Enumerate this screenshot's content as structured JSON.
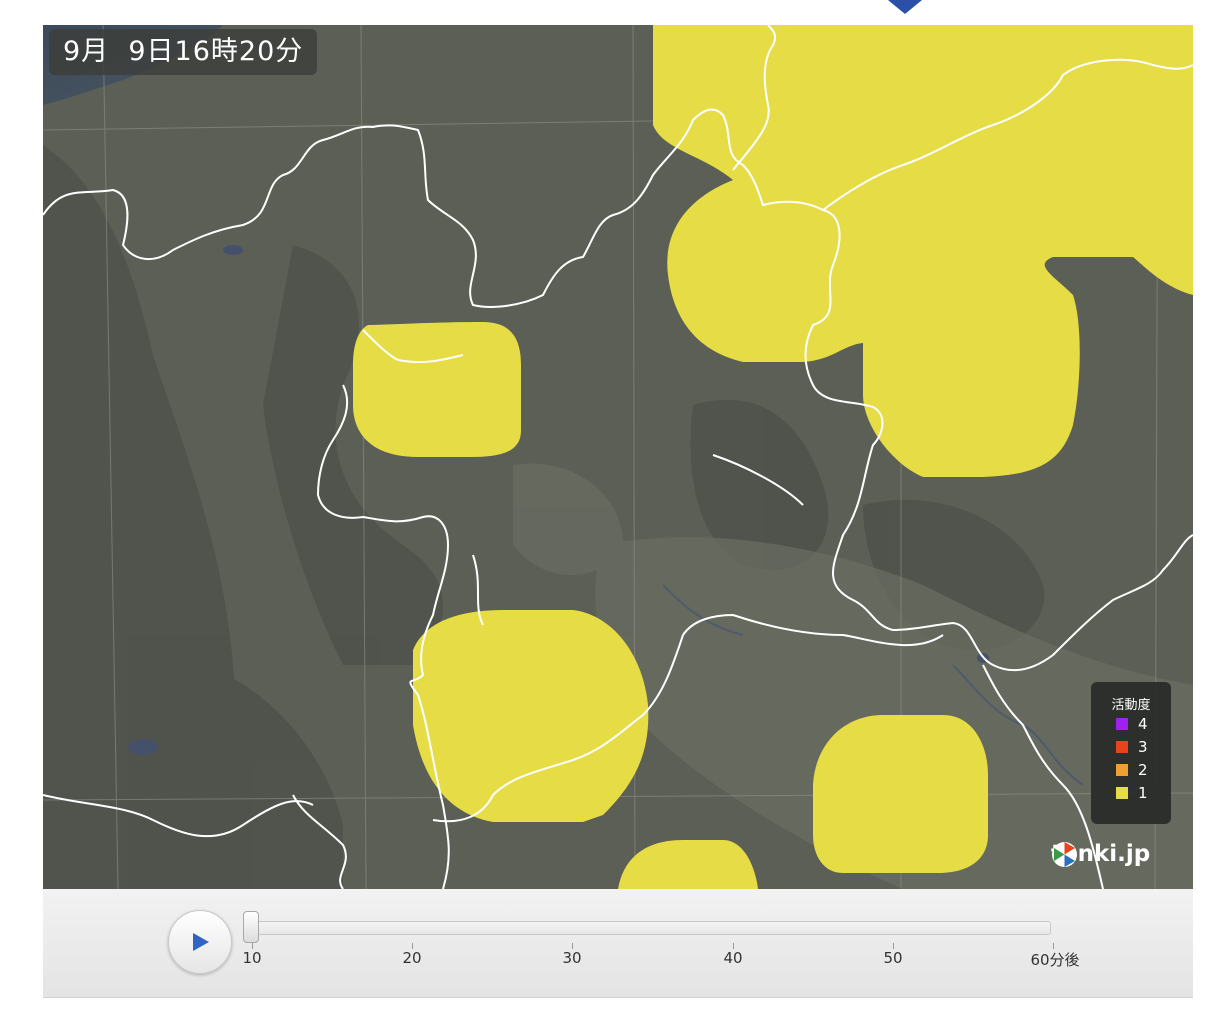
{
  "timestamp": {
    "month": "9月",
    "day_time": "9日16時20分"
  },
  "legend": {
    "title": "活動度",
    "items": [
      {
        "label": "4",
        "color": "#a020f0"
      },
      {
        "label": "3",
        "color": "#e8431c"
      },
      {
        "label": "2",
        "color": "#f0a030"
      },
      {
        "label": "1",
        "color": "#e6dc46"
      }
    ]
  },
  "brand": {
    "name": "tenki.jp",
    "icon": "tenki-logo-icon"
  },
  "player": {
    "play_icon": "play-icon",
    "current_value": 10,
    "ticks": [
      "10",
      "20",
      "30",
      "40",
      "50",
      "60分後"
    ]
  },
  "colors": {
    "map_base": "#5c5f55",
    "activity_level_1": "#e6dc46",
    "border": "#ffffff"
  }
}
